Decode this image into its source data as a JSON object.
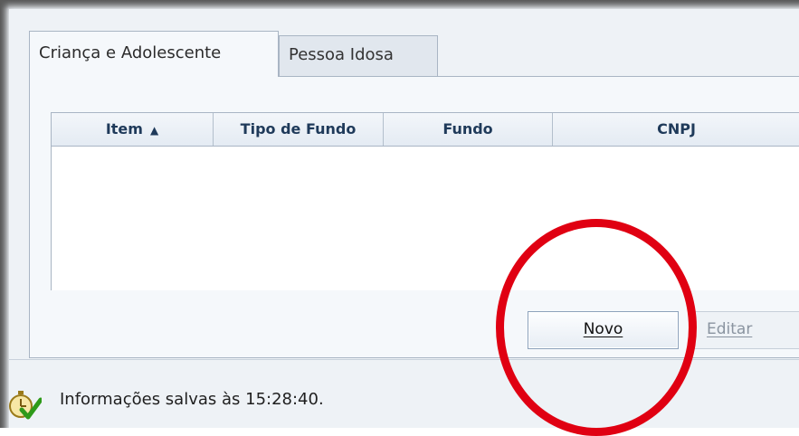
{
  "tabs": [
    {
      "label": "Criança e Adolescente",
      "active": true
    },
    {
      "label": "Pessoa Idosa",
      "active": false
    }
  ],
  "table": {
    "columns": [
      "Item",
      "Tipo de Fundo",
      "Fundo",
      "CNPJ"
    ],
    "sort_column": "Item",
    "sort_direction": "ascending",
    "rows": []
  },
  "buttons": {
    "novo": "Novo",
    "editar": "Editar"
  },
  "status": {
    "text": "Informações salvas às 15:28:40.",
    "icon": "stopwatch-check-icon"
  },
  "colors": {
    "highlight_ring": "#e00012",
    "header_text": "#1f3a5a"
  }
}
